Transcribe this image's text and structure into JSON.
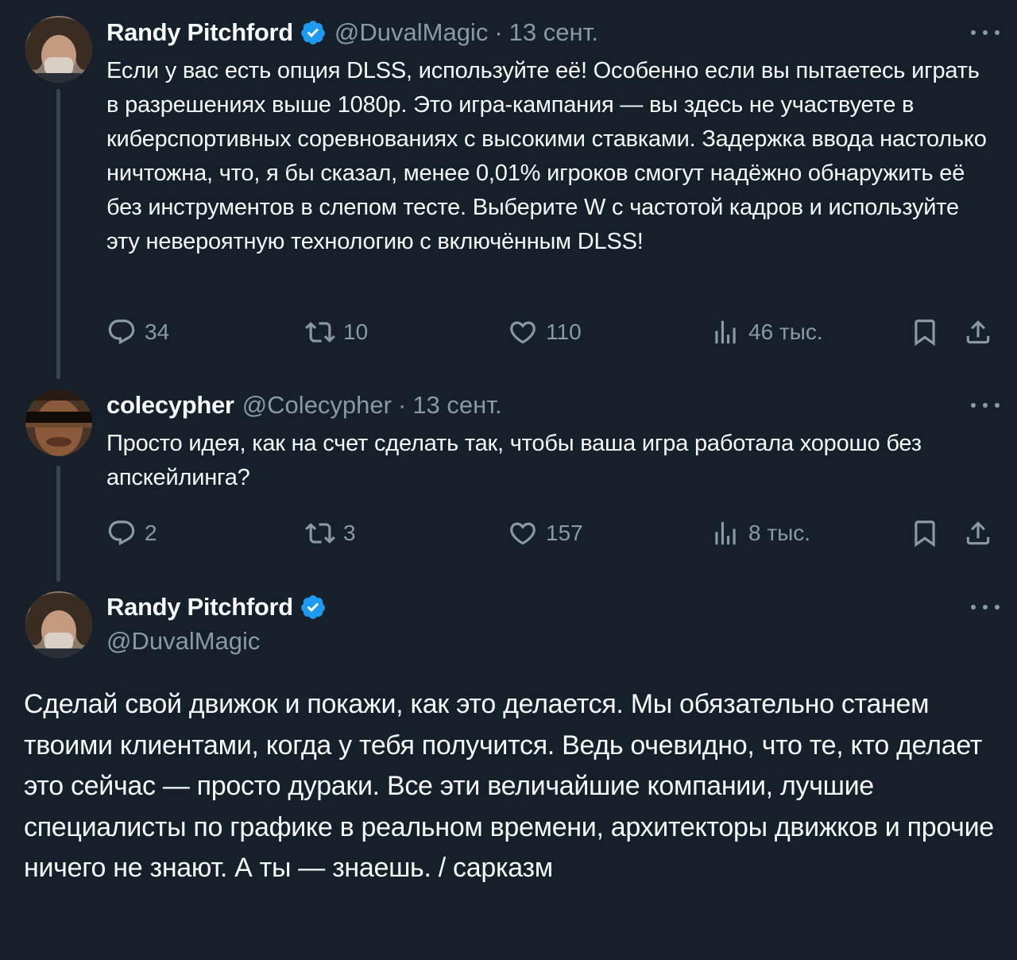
{
  "tweets": [
    {
      "author": "Randy Pitchford",
      "verified": true,
      "handle": "@DuvalMagic",
      "separator": "·",
      "date": "13 сент.",
      "text": "Если у вас есть опция DLSS, используйте её! Особенно если вы пытаетесь играть в разрешениях выше 1080p. Это игра-кампания — вы здесь не участвуете в киберспортивных соревнованиях с высокими ставками. Задержка ввода настолько ничтожна, что, я бы сказал, менее 0,01% игроков смогут надёжно обнаружить её без инструментов в слепом тесте. Выберите W с частотой кадров и используйте эту невероятную технологию с включённым DLSS!",
      "replies": "34",
      "retweets": "10",
      "likes": "110",
      "views": "46 тыс."
    },
    {
      "author": "colecypher",
      "verified": false,
      "handle": "@Colecypher",
      "separator": "·",
      "date": "13 сент.",
      "text": "Просто идея, как на счет сделать так, чтобы ваша игра работала хорошо без апскейлинга?",
      "replies": "2",
      "retweets": "3",
      "likes": "157",
      "views": "8 тыс."
    }
  ],
  "main_tweet": {
    "author": "Randy Pitchford",
    "verified": true,
    "handle": "@DuvalMagic",
    "text": "Сделай свой движок и покажи, как это делается. Мы обязательно станем твоими клиентами, когда у тебя получится. Ведь очевидно, что те, кто делает это сейчас — просто дураки. Все эти величайшие компании, лучшие специалисты по графике в реальном времени, архитекторы движков и прочие ничего не знают. А ты — знаешь. / сарказм"
  },
  "colors": {
    "background": "#15202b",
    "text_primary": "#f7f9f9",
    "text_secondary": "#8b98a5",
    "verified_badge": "#1d9bf0",
    "thread_line": "#38444d"
  },
  "icons": [
    "reply-icon",
    "retweet-icon",
    "like-icon",
    "views-icon",
    "bookmark-icon",
    "share-icon",
    "more-icon",
    "verified-icon"
  ]
}
